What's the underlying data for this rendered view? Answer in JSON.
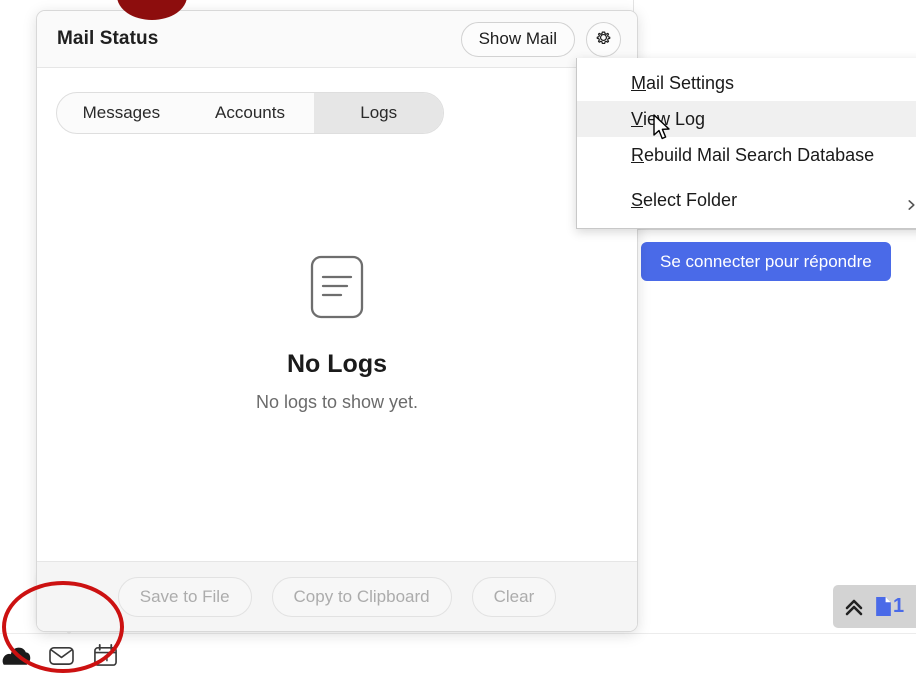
{
  "dialog": {
    "title": "Mail Status",
    "show_mail_label": "Show Mail",
    "gear_icon": "gear-icon",
    "tabs": [
      {
        "label": "Messages",
        "active": false
      },
      {
        "label": "Accounts",
        "active": false
      },
      {
        "label": "Logs",
        "active": true
      }
    ],
    "empty_state": {
      "icon": "document-lines-icon",
      "title": "No Logs",
      "subtitle": "No logs to show yet."
    },
    "footer_buttons": [
      {
        "label": "Save to File",
        "disabled": true
      },
      {
        "label": "Copy to Clipboard",
        "disabled": true
      },
      {
        "label": "Clear",
        "disabled": true
      }
    ]
  },
  "menu": {
    "items": [
      {
        "label": "Mail Settings",
        "accesskey": "M",
        "rest": "ail Settings",
        "hover": false,
        "submenu": false
      },
      {
        "label": "View Log",
        "accesskey": "V",
        "rest": "iew Log",
        "hover": true,
        "submenu": false
      },
      {
        "label": "Rebuild Mail Search Database",
        "accesskey": "R",
        "rest": "ebuild Mail Search Database",
        "hover": false,
        "submenu": false
      },
      {
        "label": "Select Folder",
        "accesskey": "S",
        "rest": "elect Folder",
        "hover": false,
        "submenu": true
      }
    ]
  },
  "right_panel": {
    "connect_button_label": "Se connecter pour répondre",
    "accent_color": "#4a6ae8"
  },
  "bottom_right_widget": {
    "collapse_icon": "double-chevron-up-icon",
    "file_icon": "file-icon",
    "file_count": "1"
  },
  "taskbar": {
    "icons": [
      {
        "name": "cloud-icon"
      },
      {
        "name": "mail-icon"
      },
      {
        "name": "calendar-icon"
      }
    ]
  },
  "annotations": {
    "ellipse_color": "#cc1111",
    "blob_color": "#8d0d0d"
  },
  "cursor": {
    "type": "arrow-pointer"
  }
}
